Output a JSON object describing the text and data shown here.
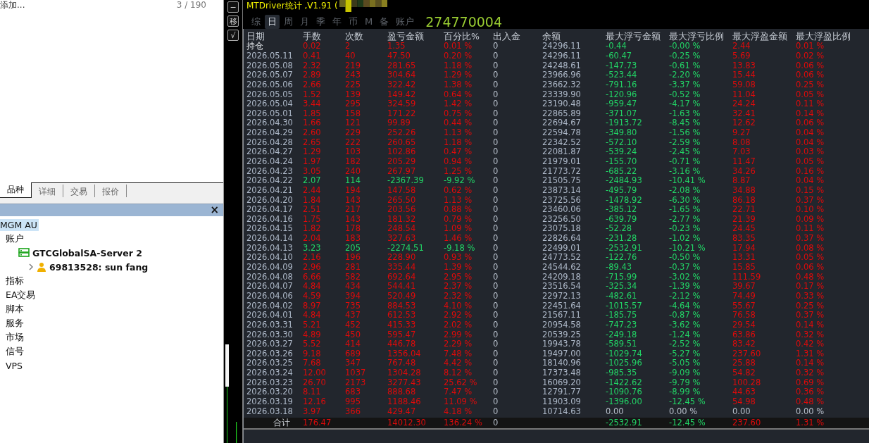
{
  "navigator": {
    "top_text": "添加...",
    "count": "3 / 190",
    "tabs": [
      {
        "label": "品种",
        "selected": true
      },
      {
        "label": "详细",
        "selected": false
      },
      {
        "label": "交易",
        "selected": false
      },
      {
        "label": "报价",
        "selected": false
      }
    ],
    "close": "×",
    "tree": [
      {
        "label": "MGM AU",
        "selected": true,
        "children": [
          {
            "label": "账户",
            "selected": false,
            "children": [
              {
                "label": "GTCGlobalSA-Server 2",
                "kind": "server",
                "selected": false,
                "children": [
                  {
                    "label": "69813528: sun fang",
                    "kind": "person",
                    "selected": false
                  }
                ]
              }
            ]
          },
          {
            "label": "指标",
            "selected": false
          },
          {
            "label": "EA交易",
            "selected": false
          },
          {
            "label": "脚本",
            "selected": false
          },
          {
            "label": "服务",
            "selected": false
          },
          {
            "label": "市场",
            "selected": false
          },
          {
            "label": "信号",
            "selected": false
          },
          {
            "label": "VPS",
            "selected": false
          }
        ]
      }
    ]
  },
  "side_buttons": [
    "−",
    "移",
    "√"
  ],
  "stats": {
    "title": "MTDriver统计 ,V1.91 (",
    "tabs": [
      {
        "label": "综",
        "selected": false
      },
      {
        "label": "日",
        "selected": true
      },
      {
        "label": "周",
        "selected": false
      },
      {
        "label": "月",
        "selected": false
      },
      {
        "label": "季",
        "selected": false
      },
      {
        "label": "年",
        "selected": false
      },
      {
        "label": "币",
        "selected": false
      },
      {
        "label": "M",
        "selected": false
      },
      {
        "label": "备",
        "selected": false
      },
      {
        "label": "账户",
        "selected": false
      }
    ],
    "account": "274770004",
    "columns": [
      "日期",
      "手数",
      "次数",
      "盈亏金额",
      "百分比%",
      "出入金",
      "余额",
      "最大浮亏金额",
      "最大浮亏比例",
      "最大浮盈金额",
      "最大浮盈比例"
    ],
    "rows": [
      {
        "cells": [
          "持仓",
          "0.02",
          "2",
          "1.35",
          "0.01 %",
          "0",
          "24296.11",
          "-0.44",
          "-0.00 %",
          "2.44",
          "0.01 %"
        ],
        "loss": false,
        "flat": false
      },
      {
        "cells": [
          "2026.05.11",
          "0.41",
          "40",
          "47.50",
          "0.20 %",
          "0",
          "24296.11",
          "-60.47",
          "-0.25 %",
          "5.69",
          "0.02 %"
        ],
        "loss": false,
        "flat": false
      },
      {
        "cells": [
          "2026.05.08",
          "2.32",
          "219",
          "281.65",
          "1.18 %",
          "0",
          "24248.61",
          "-147.73",
          "-0.61 %",
          "13.83",
          "0.06 %"
        ],
        "loss": false,
        "flat": false
      },
      {
        "cells": [
          "2026.05.07",
          "2.89",
          "243",
          "304.64",
          "1.29 %",
          "0",
          "23966.96",
          "-523.44",
          "-2.20 %",
          "15.44",
          "0.06 %"
        ],
        "loss": false,
        "flat": false
      },
      {
        "cells": [
          "2026.05.06",
          "2.66",
          "225",
          "322.42",
          "1.38 %",
          "0",
          "23662.32",
          "-791.16",
          "-3.37 %",
          "59.08",
          "0.25 %"
        ],
        "loss": false,
        "flat": false
      },
      {
        "cells": [
          "2026.05.05",
          "1.52",
          "139",
          "149.42",
          "0.64 %",
          "0",
          "23339.90",
          "-120.96",
          "-0.52 %",
          "11.04",
          "0.05 %"
        ],
        "loss": false,
        "flat": false
      },
      {
        "cells": [
          "2026.05.04",
          "3.44",
          "295",
          "324.59",
          "1.42 %",
          "0",
          "23190.48",
          "-959.47",
          "-4.17 %",
          "24.24",
          "0.11 %"
        ],
        "loss": false,
        "flat": false
      },
      {
        "cells": [
          "2026.05.01",
          "1.85",
          "158",
          "171.22",
          "0.75 %",
          "0",
          "22865.89",
          "-371.07",
          "-1.63 %",
          "32.41",
          "0.14 %"
        ],
        "loss": false,
        "flat": false
      },
      {
        "cells": [
          "2026.04.30",
          "1.66",
          "121",
          "99.89",
          "0.44 %",
          "0",
          "22694.67",
          "-1913.72",
          "-8.45 %",
          "12.62",
          "0.06 %"
        ],
        "loss": false,
        "flat": false
      },
      {
        "cells": [
          "2026.04.29",
          "2.60",
          "229",
          "252.26",
          "1.13 %",
          "0",
          "22594.78",
          "-349.80",
          "-1.56 %",
          "9.27",
          "0.04 %"
        ],
        "loss": false,
        "flat": false
      },
      {
        "cells": [
          "2026.04.28",
          "2.65",
          "222",
          "260.65",
          "1.18 %",
          "0",
          "22342.52",
          "-572.10",
          "-2.59 %",
          "8.08",
          "0.04 %"
        ],
        "loss": false,
        "flat": false
      },
      {
        "cells": [
          "2026.04.27",
          "1.29",
          "103",
          "102.86",
          "0.47 %",
          "0",
          "22081.87",
          "-539.24",
          "-2.45 %",
          "7.03",
          "0.03 %"
        ],
        "loss": false,
        "flat": false
      },
      {
        "cells": [
          "2026.04.24",
          "1.97",
          "182",
          "205.29",
          "0.94 %",
          "0",
          "21979.01",
          "-155.70",
          "-0.71 %",
          "11.47",
          "0.05 %"
        ],
        "loss": false,
        "flat": false
      },
      {
        "cells": [
          "2026.04.23",
          "3.05",
          "240",
          "267.97",
          "1.25 %",
          "0",
          "21773.72",
          "-685.22",
          "-3.16 %",
          "34.26",
          "0.16 %"
        ],
        "loss": false,
        "flat": false
      },
      {
        "cells": [
          "2026.04.22",
          "2.07",
          "114",
          "-2367.39",
          "-9.92 %",
          "0",
          "21505.75",
          "-2484.93",
          "-10.41 %",
          "8.87",
          "0.04 %"
        ],
        "loss": true,
        "flat": false
      },
      {
        "cells": [
          "2026.04.21",
          "2.44",
          "194",
          "147.58",
          "0.62 %",
          "0",
          "23873.14",
          "-495.79",
          "-2.08 %",
          "34.88",
          "0.15 %"
        ],
        "loss": false,
        "flat": false
      },
      {
        "cells": [
          "2026.04.20",
          "1.84",
          "143",
          "265.50",
          "1.13 %",
          "0",
          "23725.56",
          "-1478.92",
          "-6.30 %",
          "86.18",
          "0.37 %"
        ],
        "loss": false,
        "flat": false
      },
      {
        "cells": [
          "2026.04.17",
          "2.51",
          "217",
          "203.56",
          "0.88 %",
          "0",
          "23460.06",
          "-385.12",
          "-1.65 %",
          "22.71",
          "0.10 %"
        ],
        "loss": false,
        "flat": false
      },
      {
        "cells": [
          "2026.04.16",
          "1.75",
          "143",
          "181.32",
          "0.79 %",
          "0",
          "23256.50",
          "-639.79",
          "-2.77 %",
          "21.39",
          "0.09 %"
        ],
        "loss": false,
        "flat": false
      },
      {
        "cells": [
          "2026.04.15",
          "1.82",
          "178",
          "248.54",
          "1.09 %",
          "0",
          "23075.18",
          "-52.28",
          "-0.23 %",
          "24.45",
          "0.11 %"
        ],
        "loss": false,
        "flat": false
      },
      {
        "cells": [
          "2026.04.14",
          "2.04",
          "183",
          "327.63",
          "1.46 %",
          "0",
          "22826.64",
          "-231.28",
          "-1.02 %",
          "83.35",
          "0.37 %"
        ],
        "loss": false,
        "flat": false
      },
      {
        "cells": [
          "2026.04.13",
          "3.23",
          "205",
          "-2274.51",
          "-9.18 %",
          "0",
          "22499.01",
          "-2532.91",
          "-10.21 %",
          "17.94",
          "0.08 %"
        ],
        "loss": true,
        "flat": false
      },
      {
        "cells": [
          "2026.04.10",
          "2.16",
          "196",
          "228.90",
          "0.93 %",
          "0",
          "24773.52",
          "-122.76",
          "-0.50 %",
          "13.31",
          "0.05 %"
        ],
        "loss": false,
        "flat": false
      },
      {
        "cells": [
          "2026.04.09",
          "2.96",
          "281",
          "335.44",
          "1.39 %",
          "0",
          "24544.62",
          "-89.43",
          "-0.37 %",
          "15.85",
          "0.06 %"
        ],
        "loss": false,
        "flat": false
      },
      {
        "cells": [
          "2026.04.08",
          "6.66",
          "582",
          "692.64",
          "2.95 %",
          "0",
          "24209.18",
          "-715.99",
          "-3.02 %",
          "111.59",
          "0.48 %"
        ],
        "loss": false,
        "flat": false
      },
      {
        "cells": [
          "2026.04.07",
          "4.84",
          "434",
          "544.41",
          "2.37 %",
          "0",
          "23516.54",
          "-325.34",
          "-1.39 %",
          "39.67",
          "0.17 %"
        ],
        "loss": false,
        "flat": false
      },
      {
        "cells": [
          "2026.04.06",
          "4.59",
          "394",
          "520.49",
          "2.32 %",
          "0",
          "22972.13",
          "-482.61",
          "-2.12 %",
          "74.49",
          "0.33 %"
        ],
        "loss": false,
        "flat": false
      },
      {
        "cells": [
          "2026.04.02",
          "8.97",
          "735",
          "884.53",
          "4.10 %",
          "0",
          "22451.64",
          "-1015.57",
          "-4.64 %",
          "55.67",
          "0.25 %"
        ],
        "loss": false,
        "flat": false
      },
      {
        "cells": [
          "2026.04.01",
          "4.84",
          "437",
          "612.53",
          "2.92 %",
          "0",
          "21567.11",
          "-185.75",
          "-0.87 %",
          "76.58",
          "0.37 %"
        ],
        "loss": false,
        "flat": false
      },
      {
        "cells": [
          "2026.03.31",
          "5.21",
          "452",
          "415.33",
          "2.02 %",
          "0",
          "20954.58",
          "-747.23",
          "-3.62 %",
          "29.54",
          "0.14 %"
        ],
        "loss": false,
        "flat": false
      },
      {
        "cells": [
          "2026.03.30",
          "4.89",
          "450",
          "595.47",
          "2.99 %",
          "0",
          "20539.25",
          "-249.18",
          "-1.24 %",
          "63.86",
          "0.32 %"
        ],
        "loss": false,
        "flat": false
      },
      {
        "cells": [
          "2026.03.27",
          "5.52",
          "414",
          "446.78",
          "2.29 %",
          "0",
          "19943.78",
          "-589.51",
          "-2.52 %",
          "83.42",
          "0.42 %"
        ],
        "loss": false,
        "flat": false
      },
      {
        "cells": [
          "2026.03.26",
          "9.18",
          "689",
          "1356.04",
          "7.48 %",
          "0",
          "19497.00",
          "-1029.74",
          "-5.27 %",
          "237.60",
          "1.31 %"
        ],
        "loss": false,
        "flat": false
      },
      {
        "cells": [
          "2026.03.25",
          "7.68",
          "347",
          "767.48",
          "4.42 %",
          "0",
          "18140.96",
          "-1025.96",
          "-5.05 %",
          "25.88",
          "0.14 %"
        ],
        "loss": false,
        "flat": false
      },
      {
        "cells": [
          "2026.03.24",
          "12.00",
          "1037",
          "1304.28",
          "8.12 %",
          "0",
          "17373.48",
          "-985.35",
          "-9.09 %",
          "54.82",
          "0.32 %"
        ],
        "loss": false,
        "flat": false
      },
      {
        "cells": [
          "2026.03.23",
          "26.70",
          "2173",
          "3277.43",
          "25.62 %",
          "0",
          "16069.20",
          "-1422.62",
          "-9.79 %",
          "100.28",
          "0.69 %"
        ],
        "loss": false,
        "flat": false
      },
      {
        "cells": [
          "2026.03.20",
          "8.11",
          "683",
          "888.68",
          "7.47 %",
          "0",
          "12791.77",
          "-1090.76",
          "-8.99 %",
          "44.63",
          "0.36 %"
        ],
        "loss": false,
        "flat": false
      },
      {
        "cells": [
          "2026.03.19",
          "12.16",
          "995",
          "1188.46",
          "11.09 %",
          "0",
          "11903.09",
          "-1396.00",
          "-12.45 %",
          "54.98",
          "0.48 %"
        ],
        "loss": false,
        "flat": false
      },
      {
        "cells": [
          "2026.03.18",
          "3.97",
          "366",
          "429.47",
          "4.18 %",
          "0",
          "10714.63",
          "0.00",
          "0.00 %",
          "0.00",
          "0.00 %"
        ],
        "loss": false,
        "flat": true
      }
    ],
    "total": {
      "label": "合计",
      "lots": "176.47",
      "pnl": "14012.30",
      "pct": "136.24 %",
      "flow": "0",
      "max_dd": "-2532.91",
      "max_dd_pct": "-12.45 %",
      "max_fp": "237.60",
      "max_fp_pct": "1.31 %"
    }
  }
}
